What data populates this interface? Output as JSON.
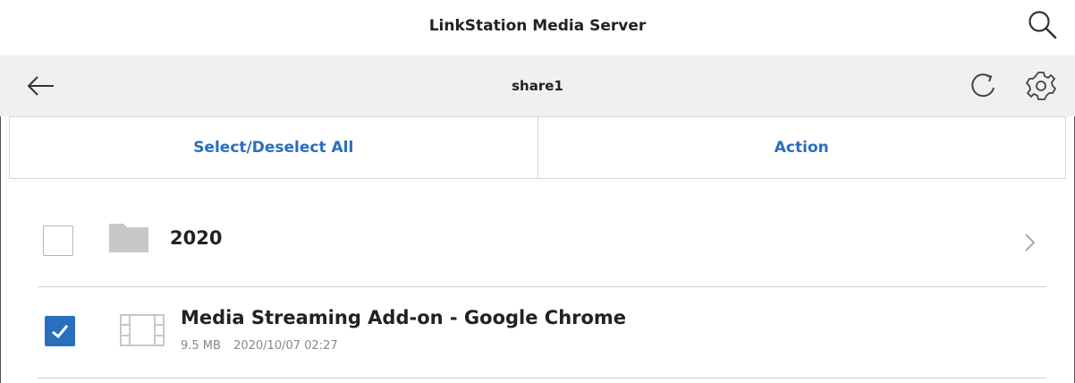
{
  "app": {
    "title": "LinkStation Media Server"
  },
  "nav": {
    "folder": "share1"
  },
  "toolbar": {
    "select_label": "Select/Deselect All",
    "action_label": "Action"
  },
  "items": [
    {
      "type": "folder",
      "name": "2020",
      "checked": false
    },
    {
      "type": "video",
      "name": "Media Streaming Add-on - Google Chrome",
      "size": "9.5 MB",
      "date": "2020/10/07 02:27",
      "checked": true
    }
  ],
  "colors": {
    "accent": "#2a6fbd",
    "navbar_bg": "#f0f0f0",
    "divider": "#cfcfcf",
    "icon_grey": "#c8c8c8"
  },
  "icons": [
    "search-icon",
    "back-arrow-icon",
    "refresh-icon",
    "gear-icon",
    "folder-icon",
    "film-icon",
    "chevron-right-icon",
    "checkmark-icon"
  ]
}
